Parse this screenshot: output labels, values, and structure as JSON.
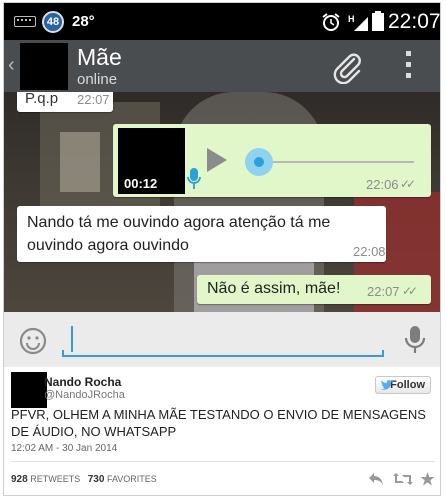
{
  "statusbar": {
    "notification_count": "48",
    "temperature": "28°",
    "network": "H",
    "clock": "22:07"
  },
  "header": {
    "contact_name": "Mãe",
    "contact_status": "online",
    "icons": [
      "back-chevron-icon",
      "attach-paperclip-icon",
      "overflow-menu-icon"
    ]
  },
  "messages": [
    {
      "direction": "in",
      "text": "P.q.p",
      "time": "22:07"
    },
    {
      "direction": "out",
      "type": "audio",
      "duration": "00:12",
      "time": "22:06",
      "ticks": "✓✓"
    },
    {
      "direction": "in",
      "text": "Nando tá me ouvindo agora atenção tá me ouvindo agora ouvindo",
      "time": "22:08"
    },
    {
      "direction": "out",
      "text": "Não é assim, mãe!",
      "time": "22:07",
      "ticks": "✓✓"
    }
  ],
  "composer": {
    "icons": [
      "emoji-icon",
      "microphone-icon"
    ]
  },
  "tweet": {
    "author_name": "Nando Rocha",
    "author_handle": "@NandoJRocha",
    "follow_label": "Follow",
    "text": "PFVR, OLHEM A MINHA MÃE TESTANDO O ENVIO DE MENSAGENS DE ÁUDIO, NO WHATSAPP",
    "timestamp": "12:02 AM - 30 Jan 2014",
    "retweets_count": "928",
    "retweets_label": "RETWEETS",
    "favorites_count": "730",
    "favorites_label": "FAVORITES"
  },
  "colors": {
    "header_bg": "#4a4d4f",
    "outgoing_bubble": "#e1f7c9",
    "incoming_bubble": "#ffffff",
    "accent_blue": "#3a9ad9",
    "audio_knob": "#2aa1d9"
  }
}
